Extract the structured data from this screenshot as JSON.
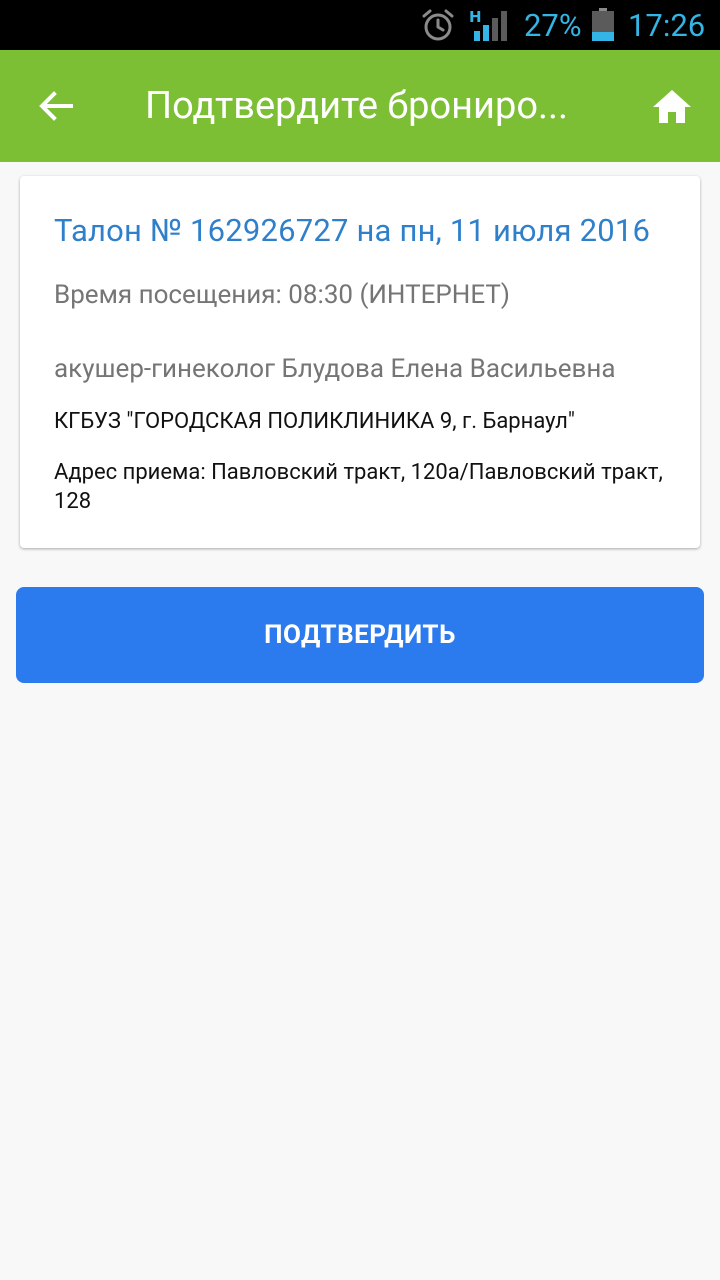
{
  "status_bar": {
    "battery_percent": "27%",
    "time": "17:26",
    "signal_label": "H",
    "icons": [
      "alarm-icon",
      "signal-icon",
      "battery-icon"
    ],
    "text_color": "#33b5e5"
  },
  "app_bar": {
    "title": "Подтвердите брониро...",
    "back_icon": "arrow-left-icon",
    "home_icon": "home-icon",
    "color": "#7cbf34"
  },
  "card": {
    "ticket_title": "Талон № 162926727 на пн, 11 июля 2016",
    "visit_time": "Время посещения: 08:30 (ИНТЕРНЕТ)",
    "doctor": "акушер-гинеколог Блудова Елена Васильевна",
    "clinic": "КГБУЗ \"ГОРОДСКАЯ ПОЛИКЛИНИКА 9, г. Барнаул\"",
    "address": "Адрес приема: Павловский тракт, 120а/Павловский тракт, 128",
    "title_color": "#2f7fcb"
  },
  "actions": {
    "confirm_label": "ПОДТВЕРДИТЬ",
    "confirm_color": "#2b7bee"
  }
}
